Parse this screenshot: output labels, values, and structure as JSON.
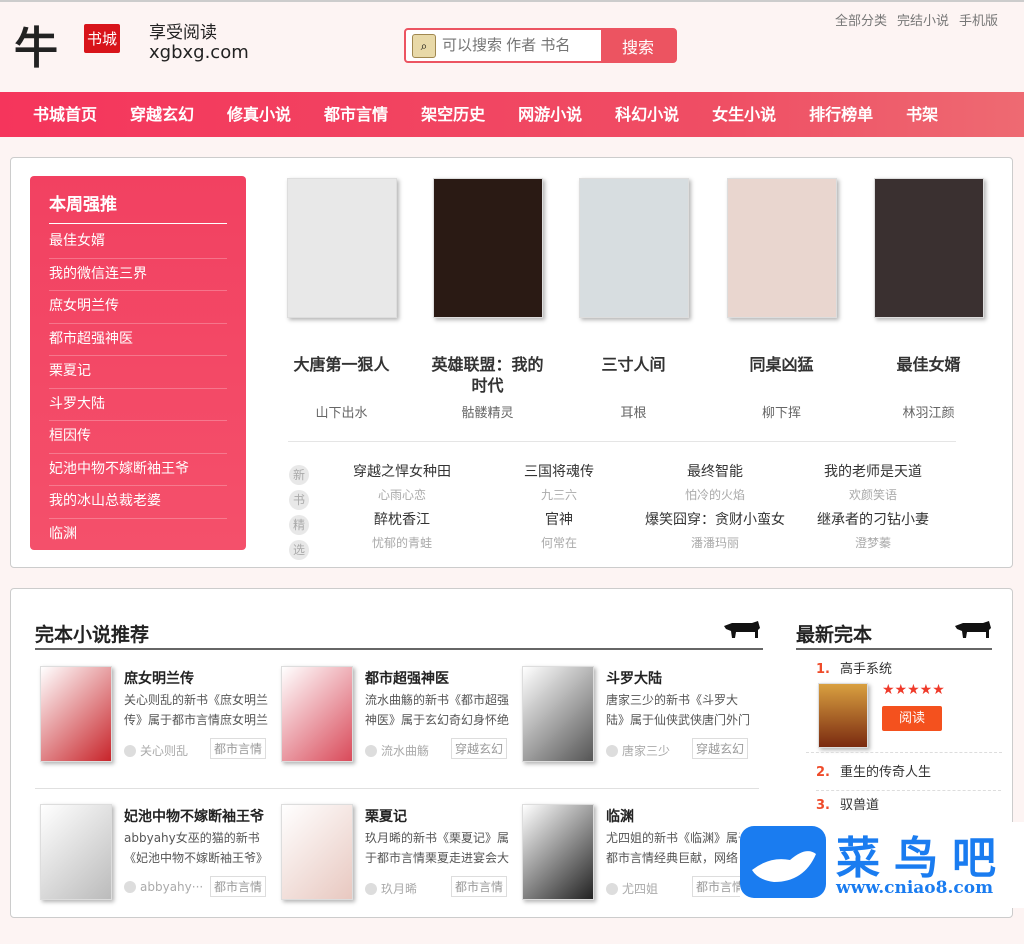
{
  "header": {
    "logo_char": "牛",
    "logo_badge": "书城",
    "slogan": "享受阅读",
    "domain": "xgbxg.com",
    "search_placeholder": "可以搜索 作者 书名",
    "search_button": "搜索",
    "top_links": [
      "全部分类",
      "完结小说",
      "手机版"
    ]
  },
  "nav": [
    "书城首页",
    "穿越玄幻",
    "修真小说",
    "都市言情",
    "架空历史",
    "网游小说",
    "科幻小说",
    "女生小说",
    "排行榜单",
    "书架"
  ],
  "weekly": {
    "title": "本周强推",
    "items": [
      "最佳女婿",
      "我的微信连三界",
      "庶女明兰传",
      "都市超强神医",
      "栗夏记",
      "斗罗大陆",
      "桓因传",
      "妃池中物不嫁断袖王爷",
      "我的冰山总裁老婆",
      "临渊"
    ]
  },
  "featured": [
    {
      "title": "大唐第一狠人",
      "author": "山下出水",
      "cover_color": "#e8e8e8"
    },
    {
      "title": "英雄联盟：我的时代",
      "author": "骷髅精灵",
      "cover_color": "#2a1a14"
    },
    {
      "title": "三寸人间",
      "author": "耳根",
      "cover_color": "#d7dde0"
    },
    {
      "title": "同桌凶猛",
      "author": "柳下挥",
      "cover_color": "#e9d6cf"
    },
    {
      "title": "最佳女婿",
      "author": "林羽江颜",
      "cover_color": "#3a3030"
    }
  ],
  "new_tags": [
    "新",
    "书",
    "精",
    "选"
  ],
  "new_books": [
    {
      "title": "穿越之悍女种田",
      "author": "心雨心恋"
    },
    {
      "title": "三国将魂传",
      "author": "九三六"
    },
    {
      "title": "最终智能",
      "author": "怕冷的火焰"
    },
    {
      "title": "我的老师是天道",
      "author": "欢颜笑语"
    },
    {
      "title": "醉枕香江",
      "author": "忧郁的青蛙"
    },
    {
      "title": "官神",
      "author": "何常在"
    },
    {
      "title": "爆笑囧穿：贪财小蛮女",
      "author": "潘潘玛丽"
    },
    {
      "title": "继承者的刁钻小妻",
      "author": "澄梦蓁"
    }
  ],
  "complete": {
    "title": "完本小说推荐",
    "items": [
      {
        "title": "庶女明兰传",
        "desc": "关心则乱的新书《庶女明兰传》属于都市言情庶女明兰",
        "author": "关心则乱",
        "category": "都市言情",
        "cover_color": "#c8242a"
      },
      {
        "title": "都市超强神医",
        "desc": "流水曲觞的新书《都市超强神医》属于玄幻奇幻身怀绝",
        "author": "流水曲觞",
        "category": "穿越玄幻",
        "cover_color": "#d94a5a"
      },
      {
        "title": "斗罗大陆",
        "desc": "唐家三少的新书《斗罗大陆》属于仙侠武侠唐门外门",
        "author": "唐家三少",
        "category": "穿越玄幻",
        "cover_color": "#555"
      },
      {
        "title": "妃池中物不嫁断袖王爷",
        "desc": "abbyahy女巫的猫的新书《妃池中物不嫁断袖王爷》",
        "author": "abbyahy···",
        "category": "都市言情",
        "cover_color": "#bbb"
      },
      {
        "title": "栗夏记",
        "desc": "玖月晞的新书《栗夏记》属于都市言情栗夏走进宴会大",
        "author": "玖月晞",
        "category": "都市言情",
        "cover_color": "#e8c8c0"
      },
      {
        "title": "临渊",
        "desc": "尤四姐的新书《临渊》属于都市言情经典巨献，网络",
        "author": "尤四姐",
        "category": "都市言情",
        "cover_color": "#222"
      }
    ]
  },
  "latest": {
    "title": "最新完本",
    "top": {
      "rank": "1.",
      "title": "高手系统",
      "stars": "★★★★★",
      "read": "阅读"
    },
    "items": [
      {
        "rank": "2.",
        "title": "重生的传奇人生"
      },
      {
        "rank": "3.",
        "title": "驭兽道"
      }
    ]
  },
  "watermark": {
    "text": "菜鸟吧",
    "url": "www.cniao8.com"
  }
}
